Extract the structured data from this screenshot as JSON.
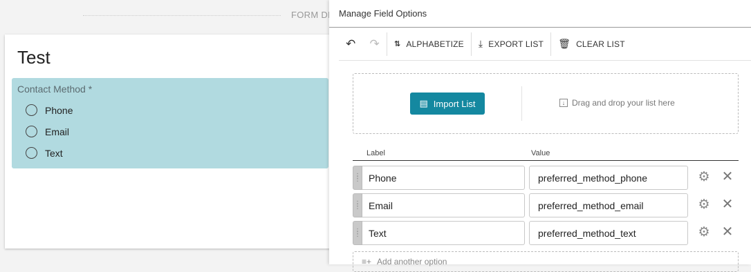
{
  "background": {
    "header_label": "FORM DE",
    "card_title": "Test",
    "field": {
      "label": "Contact Method *",
      "options": [
        "Phone",
        "Email",
        "Text"
      ]
    }
  },
  "panel": {
    "title": "Manage Field Options",
    "toolbar": {
      "undo_icon": "undo-icon",
      "redo_icon": "redo-icon",
      "alphabetize": "ALPHABETIZE",
      "export": "EXPORT LIST",
      "clear": "CLEAR LIST"
    },
    "dropzone": {
      "import_label": "Import List",
      "drop_text": "Drag and drop your list here"
    },
    "columns": {
      "label": "Label",
      "value": "Value"
    },
    "options": [
      {
        "label": "Phone",
        "value": "preferred_method_phone"
      },
      {
        "label": "Email",
        "value": "preferred_method_email"
      },
      {
        "label": "Text",
        "value": "preferred_method_text"
      }
    ],
    "add_option": "Add another option"
  },
  "colors": {
    "accent": "#1488a0",
    "field_highlight": "#b1dae0"
  }
}
